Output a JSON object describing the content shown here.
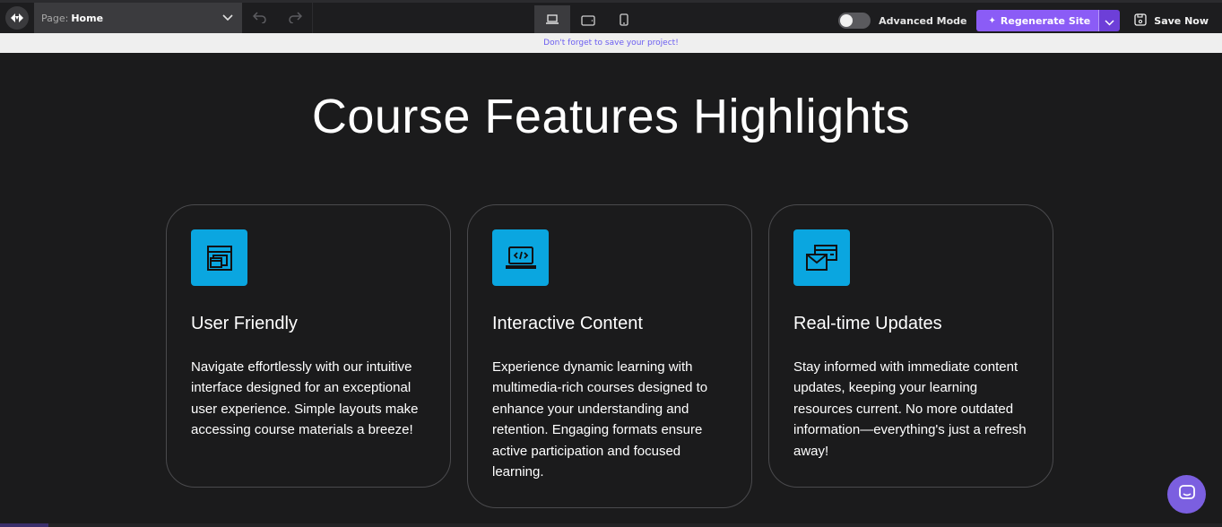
{
  "toolbar": {
    "logo_icon": "brand-logo-icon",
    "page_label": "Page:",
    "page_value": "Home",
    "undo_icon": "undo-icon",
    "redo_icon": "redo-icon",
    "devices": [
      {
        "name": "desktop",
        "icon": "laptop-icon",
        "active": true
      },
      {
        "name": "tablet",
        "icon": "tablet-icon",
        "active": false
      },
      {
        "name": "mobile",
        "icon": "phone-icon",
        "active": false
      }
    ],
    "advanced_mode_label": "Advanced Mode",
    "advanced_mode_on": false,
    "regenerate_label": "Regenerate Site",
    "save_label": "Save Now",
    "accent_color": "#8b5cf6"
  },
  "notice": {
    "text": "Don't forget to save your project!"
  },
  "main": {
    "title": "Course Features Highlights",
    "cards": [
      {
        "icon": "windows-stack-icon",
        "title": "User Friendly",
        "body": "Navigate effortlessly with our intuitive interface designed for an exceptional user experience. Simple layouts make accessing course materials a breeze!"
      },
      {
        "icon": "laptop-code-icon",
        "title": "Interactive Content",
        "body": "Experience dynamic learning with multimedia-rich courses designed to enhance your understanding and retention. Engaging formats ensure active participation and focused learning."
      },
      {
        "icon": "mail-messages-icon",
        "title": "Real-time Updates",
        "body": "Stay informed with immediate content updates, keeping your learning resources current. No more outdated information—everything's just a refresh away!"
      }
    ],
    "icon_bg_color": "#0aa6e0"
  },
  "chat_widget": {
    "icon": "chat-icon",
    "color": "#7b5fe0"
  }
}
